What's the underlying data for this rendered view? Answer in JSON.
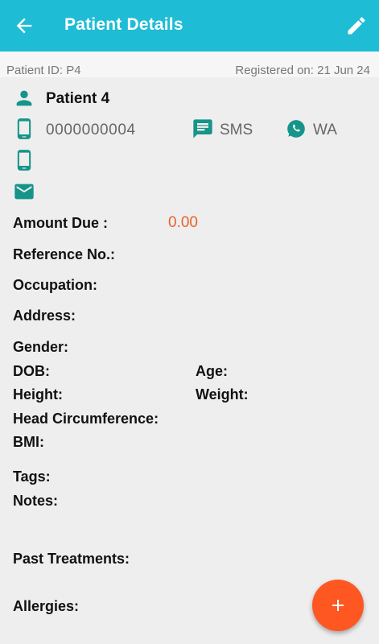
{
  "header": {
    "title": "Patient Details"
  },
  "meta": {
    "patient_id": "Patient ID: P4",
    "registered": "Registered on: 21 Jun 24"
  },
  "patient": {
    "name": "Patient 4",
    "phone": "0000000004",
    "sms_label": "SMS",
    "wa_label": "WA"
  },
  "fields": {
    "amount_due_label": "Amount Due :",
    "amount_due_value": "0.00",
    "reference_label": "Reference No.:",
    "occupation_label": "Occupation:",
    "address_label": "Address:",
    "gender_label": "Gender:",
    "dob_label": "DOB:",
    "age_label": "Age:",
    "height_label": "Height:",
    "weight_label": "Weight:",
    "head_circ_label": "Head Circumference:",
    "bmi_label": "BMI:",
    "tags_label": "Tags:",
    "notes_label": "Notes:",
    "past_treatments_label": "Past Treatments:",
    "allergies_label": "Allergies:"
  },
  "icons": {
    "back": "arrow-back-icon",
    "edit": "pencil-icon",
    "person": "person-icon",
    "mobile": "mobile-phone-icon",
    "sms": "message-icon",
    "whatsapp": "whatsapp-icon",
    "email": "email-icon",
    "fab": "add-icon"
  },
  "colors": {
    "appbar": "#1fbcd6",
    "accent_teal": "#16948a",
    "amount_due": "#e8622e",
    "fab": "#ff5722"
  }
}
